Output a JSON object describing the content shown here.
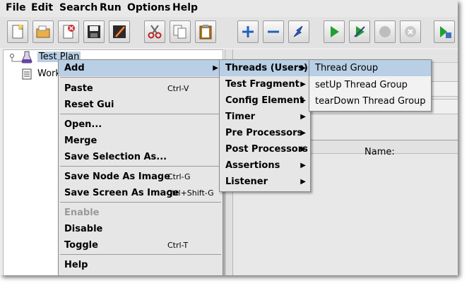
{
  "menubar": {
    "file": "File",
    "edit": "Edit",
    "search": "Search",
    "run": "Run",
    "options": "Options",
    "help": "Help"
  },
  "toolbar": {
    "buttons": [
      "new-icon",
      "open-icon",
      "close-icon",
      "save-icon",
      "save-as-icon",
      "cut-icon",
      "copy-icon",
      "paste-icon",
      "expand-icon",
      "collapse-icon",
      "toggle-icon",
      "start-icon",
      "start-no-pause-icon",
      "stop-icon",
      "shutdown-icon",
      "remote-start-icon"
    ]
  },
  "tree": {
    "test_plan": "Test Plan",
    "workbench": "Work"
  },
  "right_panel": {
    "name_label": "Name:"
  },
  "context_menu": {
    "add": "Add",
    "paste": "Paste",
    "paste_shortcut": "Ctrl-V",
    "reset_gui": "Reset Gui",
    "open": "Open...",
    "merge": "Merge",
    "save_selection": "Save Selection As...",
    "save_node_image": "Save Node As Image",
    "save_node_image_shortcut": "Ctrl-G",
    "save_screen_image": "Save Screen As Image",
    "save_screen_image_shortcut": "Ctrl+Shift-G",
    "enable": "Enable",
    "disable": "Disable",
    "toggle": "Toggle",
    "toggle_shortcut": "Ctrl-T",
    "help": "Help"
  },
  "add_submenu": {
    "threads": "Threads (Users)",
    "test_fragment": "Test Fragment",
    "config_element": "Config Element",
    "timer": "Timer",
    "pre_processors": "Pre Processors",
    "post_processors": "Post Processors",
    "assertions": "Assertions",
    "listener": "Listener"
  },
  "threads_submenu": {
    "thread_group": "Thread Group",
    "setup_thread_group": "setUp Thread Group",
    "teardown_thread_group": "tearDown Thread Group"
  },
  "colors": {
    "highlight": "#b8cfe5",
    "menu_bg": "#e6e6e6",
    "disabled": "#9a9a9a"
  }
}
